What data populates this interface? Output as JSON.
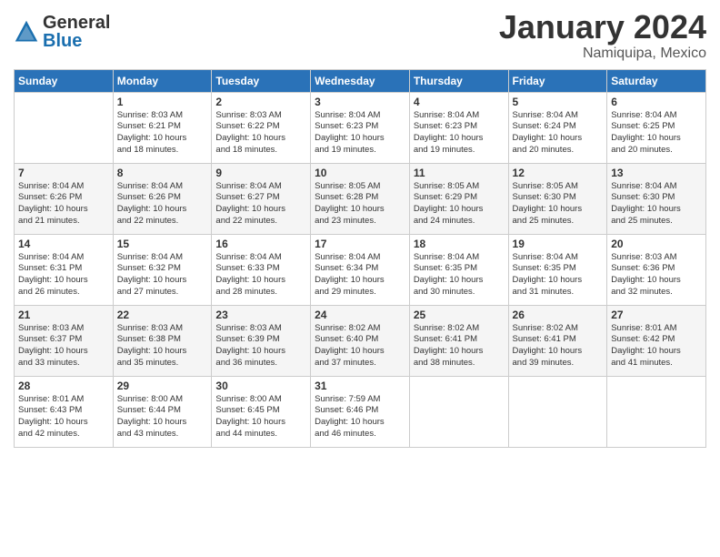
{
  "header": {
    "logo_general": "General",
    "logo_blue": "Blue",
    "title": "January 2024",
    "subtitle": "Namiquipa, Mexico"
  },
  "columns": [
    "Sunday",
    "Monday",
    "Tuesday",
    "Wednesday",
    "Thursday",
    "Friday",
    "Saturday"
  ],
  "weeks": [
    [
      {
        "day": "",
        "info": ""
      },
      {
        "day": "1",
        "info": "Sunrise: 8:03 AM\nSunset: 6:21 PM\nDaylight: 10 hours\nand 18 minutes."
      },
      {
        "day": "2",
        "info": "Sunrise: 8:03 AM\nSunset: 6:22 PM\nDaylight: 10 hours\nand 18 minutes."
      },
      {
        "day": "3",
        "info": "Sunrise: 8:04 AM\nSunset: 6:23 PM\nDaylight: 10 hours\nand 19 minutes."
      },
      {
        "day": "4",
        "info": "Sunrise: 8:04 AM\nSunset: 6:23 PM\nDaylight: 10 hours\nand 19 minutes."
      },
      {
        "day": "5",
        "info": "Sunrise: 8:04 AM\nSunset: 6:24 PM\nDaylight: 10 hours\nand 20 minutes."
      },
      {
        "day": "6",
        "info": "Sunrise: 8:04 AM\nSunset: 6:25 PM\nDaylight: 10 hours\nand 20 minutes."
      }
    ],
    [
      {
        "day": "7",
        "info": "Sunrise: 8:04 AM\nSunset: 6:26 PM\nDaylight: 10 hours\nand 21 minutes."
      },
      {
        "day": "8",
        "info": "Sunrise: 8:04 AM\nSunset: 6:26 PM\nDaylight: 10 hours\nand 22 minutes."
      },
      {
        "day": "9",
        "info": "Sunrise: 8:04 AM\nSunset: 6:27 PM\nDaylight: 10 hours\nand 22 minutes."
      },
      {
        "day": "10",
        "info": "Sunrise: 8:05 AM\nSunset: 6:28 PM\nDaylight: 10 hours\nand 23 minutes."
      },
      {
        "day": "11",
        "info": "Sunrise: 8:05 AM\nSunset: 6:29 PM\nDaylight: 10 hours\nand 24 minutes."
      },
      {
        "day": "12",
        "info": "Sunrise: 8:05 AM\nSunset: 6:30 PM\nDaylight: 10 hours\nand 25 minutes."
      },
      {
        "day": "13",
        "info": "Sunrise: 8:04 AM\nSunset: 6:30 PM\nDaylight: 10 hours\nand 25 minutes."
      }
    ],
    [
      {
        "day": "14",
        "info": "Sunrise: 8:04 AM\nSunset: 6:31 PM\nDaylight: 10 hours\nand 26 minutes."
      },
      {
        "day": "15",
        "info": "Sunrise: 8:04 AM\nSunset: 6:32 PM\nDaylight: 10 hours\nand 27 minutes."
      },
      {
        "day": "16",
        "info": "Sunrise: 8:04 AM\nSunset: 6:33 PM\nDaylight: 10 hours\nand 28 minutes."
      },
      {
        "day": "17",
        "info": "Sunrise: 8:04 AM\nSunset: 6:34 PM\nDaylight: 10 hours\nand 29 minutes."
      },
      {
        "day": "18",
        "info": "Sunrise: 8:04 AM\nSunset: 6:35 PM\nDaylight: 10 hours\nand 30 minutes."
      },
      {
        "day": "19",
        "info": "Sunrise: 8:04 AM\nSunset: 6:35 PM\nDaylight: 10 hours\nand 31 minutes."
      },
      {
        "day": "20",
        "info": "Sunrise: 8:03 AM\nSunset: 6:36 PM\nDaylight: 10 hours\nand 32 minutes."
      }
    ],
    [
      {
        "day": "21",
        "info": "Sunrise: 8:03 AM\nSunset: 6:37 PM\nDaylight: 10 hours\nand 33 minutes."
      },
      {
        "day": "22",
        "info": "Sunrise: 8:03 AM\nSunset: 6:38 PM\nDaylight: 10 hours\nand 35 minutes."
      },
      {
        "day": "23",
        "info": "Sunrise: 8:03 AM\nSunset: 6:39 PM\nDaylight: 10 hours\nand 36 minutes."
      },
      {
        "day": "24",
        "info": "Sunrise: 8:02 AM\nSunset: 6:40 PM\nDaylight: 10 hours\nand 37 minutes."
      },
      {
        "day": "25",
        "info": "Sunrise: 8:02 AM\nSunset: 6:41 PM\nDaylight: 10 hours\nand 38 minutes."
      },
      {
        "day": "26",
        "info": "Sunrise: 8:02 AM\nSunset: 6:41 PM\nDaylight: 10 hours\nand 39 minutes."
      },
      {
        "day": "27",
        "info": "Sunrise: 8:01 AM\nSunset: 6:42 PM\nDaylight: 10 hours\nand 41 minutes."
      }
    ],
    [
      {
        "day": "28",
        "info": "Sunrise: 8:01 AM\nSunset: 6:43 PM\nDaylight: 10 hours\nand 42 minutes."
      },
      {
        "day": "29",
        "info": "Sunrise: 8:00 AM\nSunset: 6:44 PM\nDaylight: 10 hours\nand 43 minutes."
      },
      {
        "day": "30",
        "info": "Sunrise: 8:00 AM\nSunset: 6:45 PM\nDaylight: 10 hours\nand 44 minutes."
      },
      {
        "day": "31",
        "info": "Sunrise: 7:59 AM\nSunset: 6:46 PM\nDaylight: 10 hours\nand 46 minutes."
      },
      {
        "day": "",
        "info": ""
      },
      {
        "day": "",
        "info": ""
      },
      {
        "day": "",
        "info": ""
      }
    ]
  ]
}
